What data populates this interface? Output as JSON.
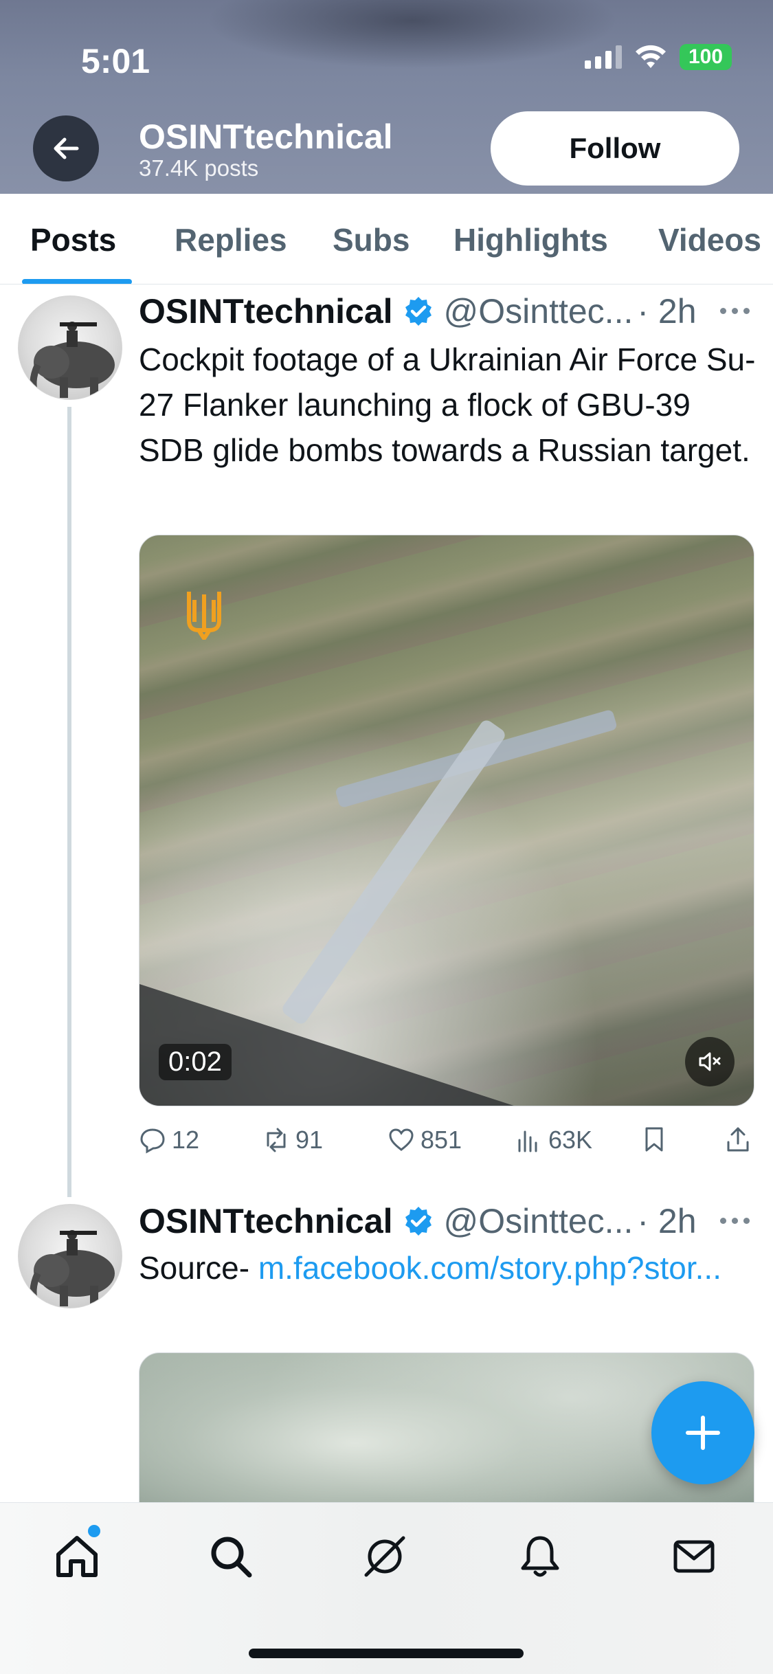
{
  "status_bar": {
    "time": "5:01",
    "battery": "100"
  },
  "header": {
    "title": "OSINTtechnical",
    "subtitle": "37.4K posts",
    "follow_label": "Follow"
  },
  "tabs": [
    {
      "label": "Posts",
      "active": true
    },
    {
      "label": "Replies",
      "active": false
    },
    {
      "label": "Subs",
      "active": false
    },
    {
      "label": "Highlights",
      "active": false
    },
    {
      "label": "Videos",
      "active": false
    }
  ],
  "tweets": [
    {
      "name": "OSINTtechnical",
      "handle": "@Osinttec...",
      "time": "· 2h",
      "text": "Cockpit footage of a Ukrainian Air Force Su-27 Flanker launching a flock of GBU-39 SDB glide bombs towards a Russian target.",
      "media": {
        "duration": "0:02",
        "muted": true
      },
      "actions": {
        "replies": "12",
        "reposts": "91",
        "likes": "851",
        "views": "63K"
      }
    },
    {
      "name": "OSINTtechnical",
      "handle": "@Osinttec...",
      "time": "· 2h",
      "text_prefix": "Source- ",
      "link_text": "m.facebook.com/story.php?stor..."
    }
  ],
  "bottom_nav": {
    "items": [
      "home-icon",
      "search-icon",
      "grok-icon",
      "notifications-icon",
      "messages-icon"
    ],
    "home_has_badge": true
  },
  "colors": {
    "accent": "#1d9bf0",
    "text_primary": "#0f1419",
    "text_secondary": "#536471",
    "battery": "#34c759"
  }
}
